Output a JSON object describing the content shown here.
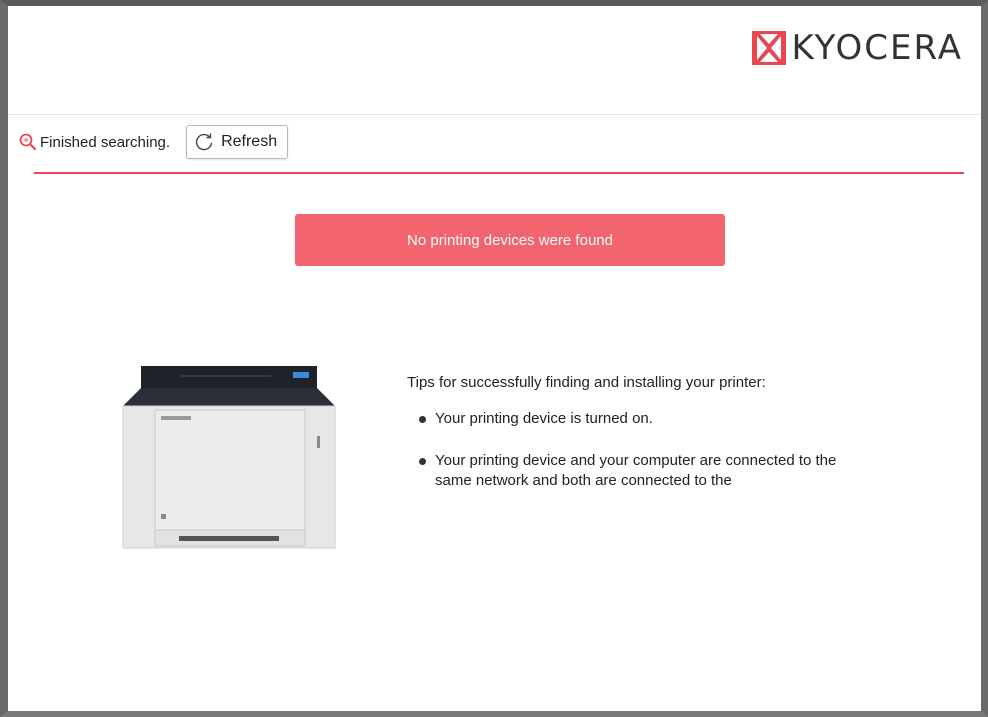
{
  "brand": {
    "name": "KYOCERA",
    "colors": {
      "red": "#e8474f",
      "banner": "#f2646e"
    }
  },
  "search": {
    "status": "Finished searching.",
    "refresh_label": "Refresh"
  },
  "alert": {
    "message": "No printing devices were found"
  },
  "tips": {
    "title": "Tips for successfully finding and installing your printer:",
    "items": [
      {
        "text": "Your printing device is turned on."
      },
      {
        "text": "Your printing device and your computer are connected to the same network and both are connected to the"
      }
    ]
  },
  "icons": {
    "logo": "kyocera-logo-icon",
    "search": "search-status-icon",
    "refresh": "refresh-icon",
    "printer": "printer-illustration"
  }
}
